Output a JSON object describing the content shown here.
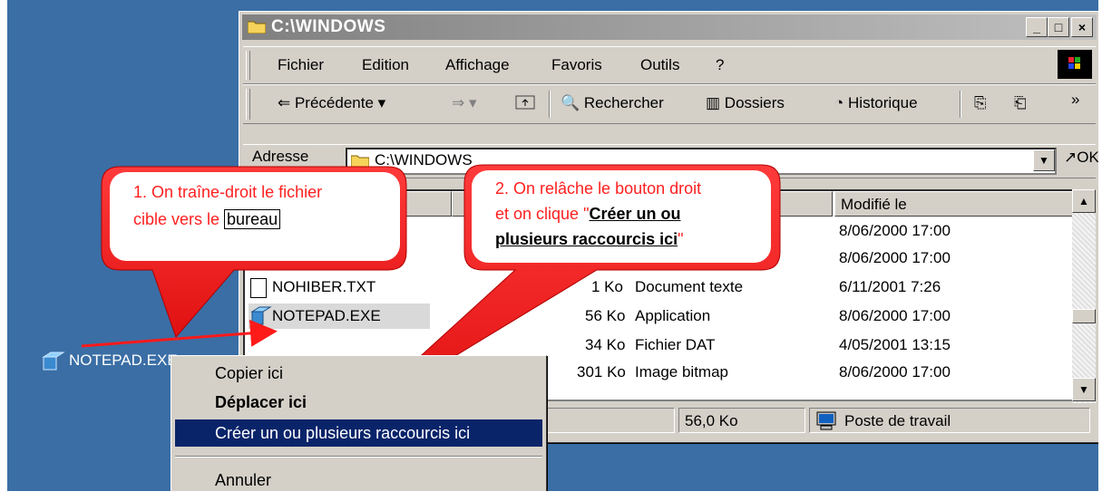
{
  "window": {
    "title": "C:\\WINDOWS",
    "min_glyph": "_",
    "max_glyph": "□",
    "close_glyph": "×"
  },
  "menu": [
    {
      "label": "Fichier"
    },
    {
      "label": "Edition"
    },
    {
      "label": "Affichage"
    },
    {
      "label": "Favoris"
    },
    {
      "label": "Outils"
    },
    {
      "label": "?"
    }
  ],
  "toolbar": {
    "back_label": "Précédente",
    "search_label": "Rechercher",
    "folders_label": "Dossiers",
    "history_label": "Historique",
    "more_glyph": "»"
  },
  "address": {
    "label": "Adresse",
    "value": "C:\\WINDOWS",
    "go_label": "OK"
  },
  "list": {
    "col_modified": "Modifié le",
    "rows": [
      {
        "name": "",
        "size": "",
        "type": "",
        "modified": "8/06/2000 17:00"
      },
      {
        "name": "",
        "size": "",
        "type": "",
        "modified": "8/06/2000 17:00"
      },
      {
        "name": "NOHIBER.TXT",
        "size": "1 Ko",
        "type": "Document texte",
        "modified": "6/11/2001 7:26"
      },
      {
        "name": "NOTEPAD.EXE",
        "size": "56 Ko",
        "type": "Application",
        "modified": "8/06/2000 17:00"
      },
      {
        "name": "",
        "size": "34 Ko",
        "type": "Fichier DAT",
        "modified": "4/05/2001 13:15"
      },
      {
        "name": "",
        "size": "301 Ko",
        "type": "Image bitmap",
        "modified": "8/06/2000 17:00"
      }
    ]
  },
  "status": {
    "size": "56,0 Ko",
    "zone": "Poste de travail"
  },
  "callout1": {
    "line1": "1. On traîne-droit le fichier",
    "line2_prefix": "cible vers le ",
    "line2_boxed": "bureau"
  },
  "callout2": {
    "line1": "2. On relâche le bouton droit",
    "line2_prefix": "et on clique \"",
    "line2_bold": "Créer un ou",
    "line3_bold": "plusieurs raccourcis ici",
    "line3_suffix": "\""
  },
  "context_menu": {
    "copy": "Copier ici",
    "move": "Déplacer ici",
    "shortcut": "Créer un ou plusieurs raccourcis ici",
    "cancel": "Annuler"
  },
  "desktop_icon": {
    "label": "NOTEPAD.EXE"
  },
  "colors": {
    "desktop": "#3a6ea5",
    "callout_fill": "#ff2020",
    "arrow": "#ff1a1a",
    "selection": "#0a246a"
  }
}
